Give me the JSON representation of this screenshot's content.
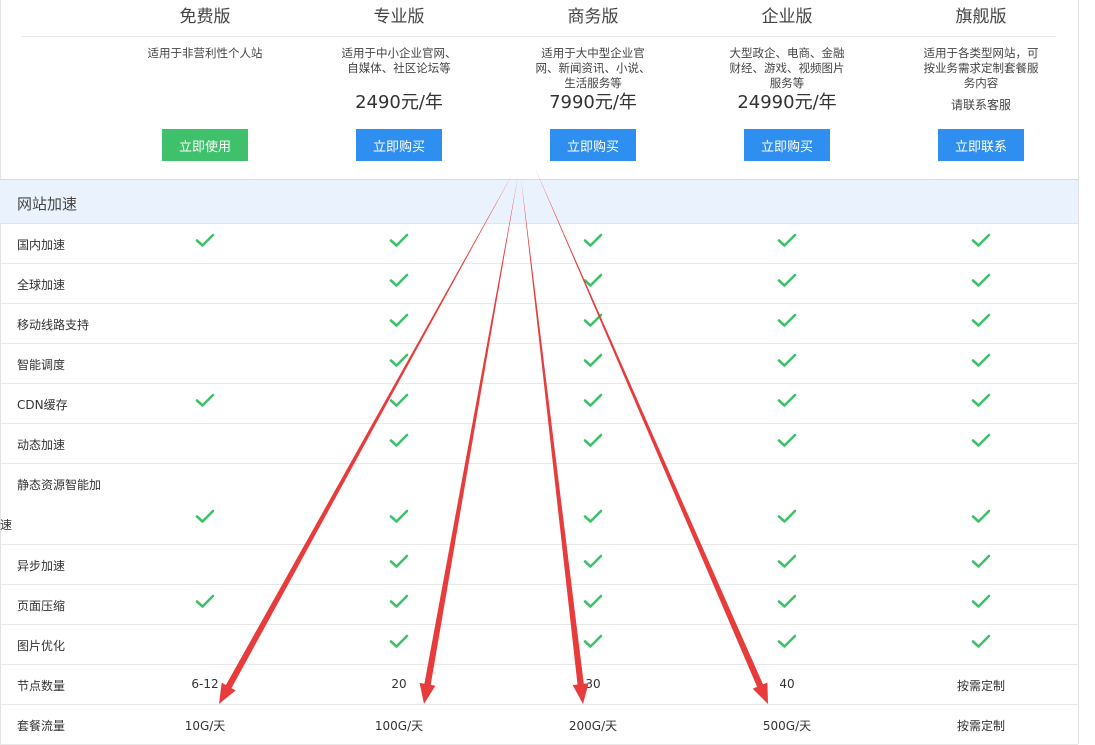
{
  "plans": [
    {
      "name": "免费版",
      "desc": [
        "适用于非营利性个人站"
      ],
      "price": "",
      "contact": "",
      "button": "立即使用",
      "button_color": "#3fc06a"
    },
    {
      "name": "专业版",
      "desc": [
        "适用于中小企业官网、",
        "自媒体、社区论坛等"
      ],
      "price": "2490元/年",
      "contact": "",
      "button": "立即购买",
      "button_color": "#2f8ff0"
    },
    {
      "name": "商务版",
      "desc": [
        "适用于大中型企业官",
        "网、新闻资讯、小说、",
        "生活服务等"
      ],
      "price": "7990元/年",
      "contact": "",
      "button": "立即购买",
      "button_color": "#2f8ff0"
    },
    {
      "name": "企业版",
      "desc": [
        "大型政企、电商、金融",
        "财经、游戏、视频图片",
        "服务等"
      ],
      "price": "24990元/年",
      "contact": "",
      "button": "立即购买",
      "button_color": "#2f8ff0"
    },
    {
      "name": "旗舰版",
      "desc": [
        "适用于各类型网站，可",
        "按业务需求定制套餐服",
        "务内容"
      ],
      "price": "",
      "contact": "请联系客服",
      "button": "立即联系",
      "button_color": "#2f8ff0"
    }
  ],
  "section": {
    "title": "网站加速"
  },
  "features": [
    {
      "label": "国内加速",
      "checks": [
        true,
        true,
        true,
        true,
        true
      ]
    },
    {
      "label": "全球加速",
      "checks": [
        false,
        true,
        true,
        true,
        true
      ]
    },
    {
      "label": "移动线路支持",
      "checks": [
        false,
        true,
        true,
        true,
        true
      ]
    },
    {
      "label": "智能调度",
      "checks": [
        false,
        true,
        true,
        true,
        true
      ]
    },
    {
      "label": "CDN缓存",
      "checks": [
        true,
        true,
        true,
        true,
        true
      ]
    },
    {
      "label": "动态加速",
      "checks": [
        false,
        true,
        true,
        true,
        true
      ]
    },
    {
      "label": "静态资源智能加",
      "label_wrap": "速",
      "checks": [
        true,
        true,
        true,
        true,
        true
      ]
    },
    {
      "label": "异步加速",
      "checks": [
        false,
        true,
        true,
        true,
        true
      ]
    },
    {
      "label": "页面压缩",
      "checks": [
        true,
        true,
        true,
        true,
        true
      ]
    },
    {
      "label": "图片优化",
      "checks": [
        false,
        true,
        true,
        true,
        true
      ]
    }
  ],
  "value_rows": [
    {
      "label": "节点数量",
      "values": [
        "6-12",
        "20",
        "30",
        "40",
        "按需定制"
      ]
    },
    {
      "label": "套餐流量",
      "values": [
        "10G/天",
        "100G/天",
        "200G/天",
        "500G/天",
        "按需定制"
      ]
    }
  ],
  "colors": {
    "check": "#3fc06a",
    "arrow": "#e83b3b",
    "section_bg": "#eaf3fd"
  },
  "icons": {
    "check": "check-icon",
    "arrow": "red-arrow-annotation"
  }
}
